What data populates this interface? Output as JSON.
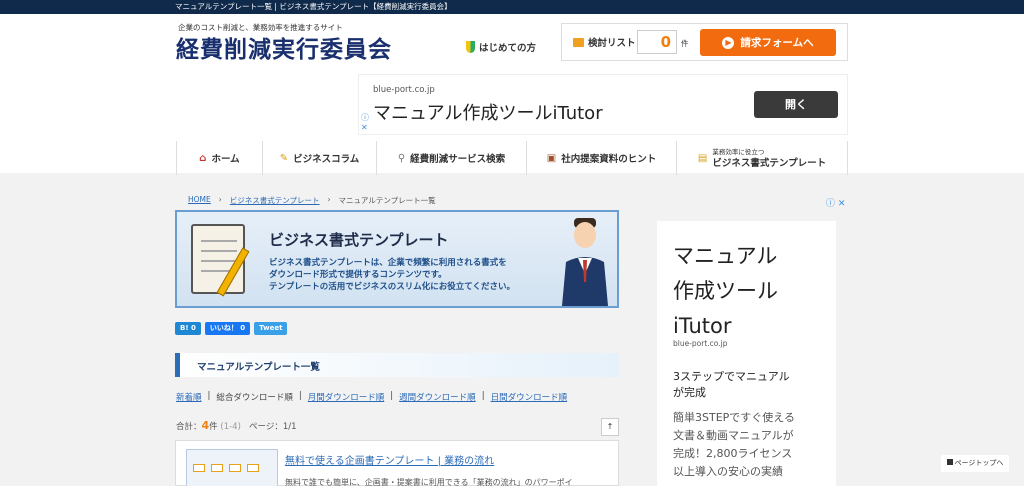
{
  "topbar": {
    "text": "マニュアルテンプレート一覧 | ビジネス書式テンプレート【経費削減実行委員会】"
  },
  "header": {
    "tagline": "企業のコスト削減と、業務効率を推進するサイト",
    "logo": "経費削減実行委員会",
    "beginner_link": "はじめての方",
    "check_list_label": "検討リスト",
    "check_count": "0",
    "check_unit": "件",
    "request_button": "請求フォームへ"
  },
  "top_ad": {
    "domain": "blue-port.co.jp",
    "title": "マニュアル作成ツールiTutor",
    "button": "開く"
  },
  "nav": {
    "items": [
      {
        "label": "ホーム",
        "icon": "home-icon"
      },
      {
        "label": "ビジネスコラム",
        "icon": "pencil-icon"
      },
      {
        "label": "経費削減サービス検索",
        "icon": "search-icon"
      },
      {
        "label": "社内提案資料のヒント",
        "icon": "briefcase-icon"
      },
      {
        "sub": "業務効率に役立つ",
        "label": "ビジネス書式テンプレート",
        "icon": "document-icon"
      }
    ]
  },
  "breadcrumb": {
    "home": "HOME",
    "section": "ビジネス書式テンプレート",
    "current": "マニュアルテンプレート一覧"
  },
  "banner": {
    "title": "ビジネス書式テンプレート",
    "line1": "ビジネス書式テンプレートは、企業で頻繁に利用される書式を",
    "line2": "ダウンロード形式で提供するコンテンツです。",
    "line3": "テンプレートの活用でビジネスのスリム化にお役立てください。"
  },
  "social": {
    "hatena": "B! 0",
    "facebook": "いいね！ 0",
    "twitter": "Tweet"
  },
  "section": {
    "title": "マニュアルテンプレート一覧"
  },
  "sort": {
    "options": [
      "新着順",
      "総合ダウンロード順",
      "月間ダウンロード順",
      "週間ダウンロード順",
      "日間ダウンロード順"
    ],
    "separator": "|"
  },
  "summary": {
    "total_label": "合計：",
    "count": "4",
    "unit": "件",
    "range": "(1-4)",
    "page": "ページ：1/1",
    "toggle": "↑"
  },
  "items": [
    {
      "title": "無料で使える企画書テンプレート | 業務の流れ",
      "excerpt": "無料で誰でも簡単に、企画書・提案書に利用できる「業務の流れ」のパワーポイ"
    }
  ],
  "side_ad": {
    "title": "マニュアル作成ツールiTutor",
    "title_lines": [
      "マニュアル",
      "作成ツール",
      "iTutor"
    ],
    "domain": "blue-port.co.jp",
    "headline_lines": [
      "3ステップでマニュアル",
      "が完成"
    ],
    "body_lines": [
      "簡単3STEPですぐ使える",
      "文書＆動画マニュアルが",
      "完成！2,800ライセンス",
      "以上導入の安心の実績"
    ]
  },
  "page_top": "ページトップへ",
  "colors": {
    "topbar": "#0f2a4a",
    "logo": "#1a2f6e",
    "accent_orange": "#f26b0f",
    "link_blue": "#2a6ab8"
  }
}
